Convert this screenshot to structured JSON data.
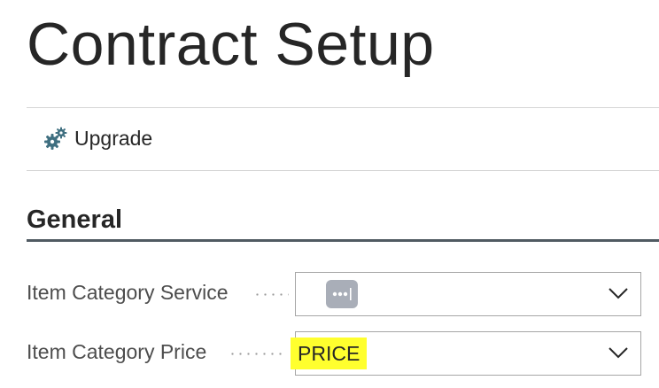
{
  "page": {
    "title": "Contract Setup"
  },
  "actions": {
    "upgrade_label": "Upgrade"
  },
  "section": {
    "title": "General"
  },
  "fields": [
    {
      "label": "Item Category Service",
      "value": ""
    },
    {
      "label": "Item Category Price",
      "value": "PRICE"
    }
  ],
  "colors": {
    "highlight": "#ffff2e",
    "badge": "#a9aeb8",
    "section_rule": "#505a62"
  }
}
